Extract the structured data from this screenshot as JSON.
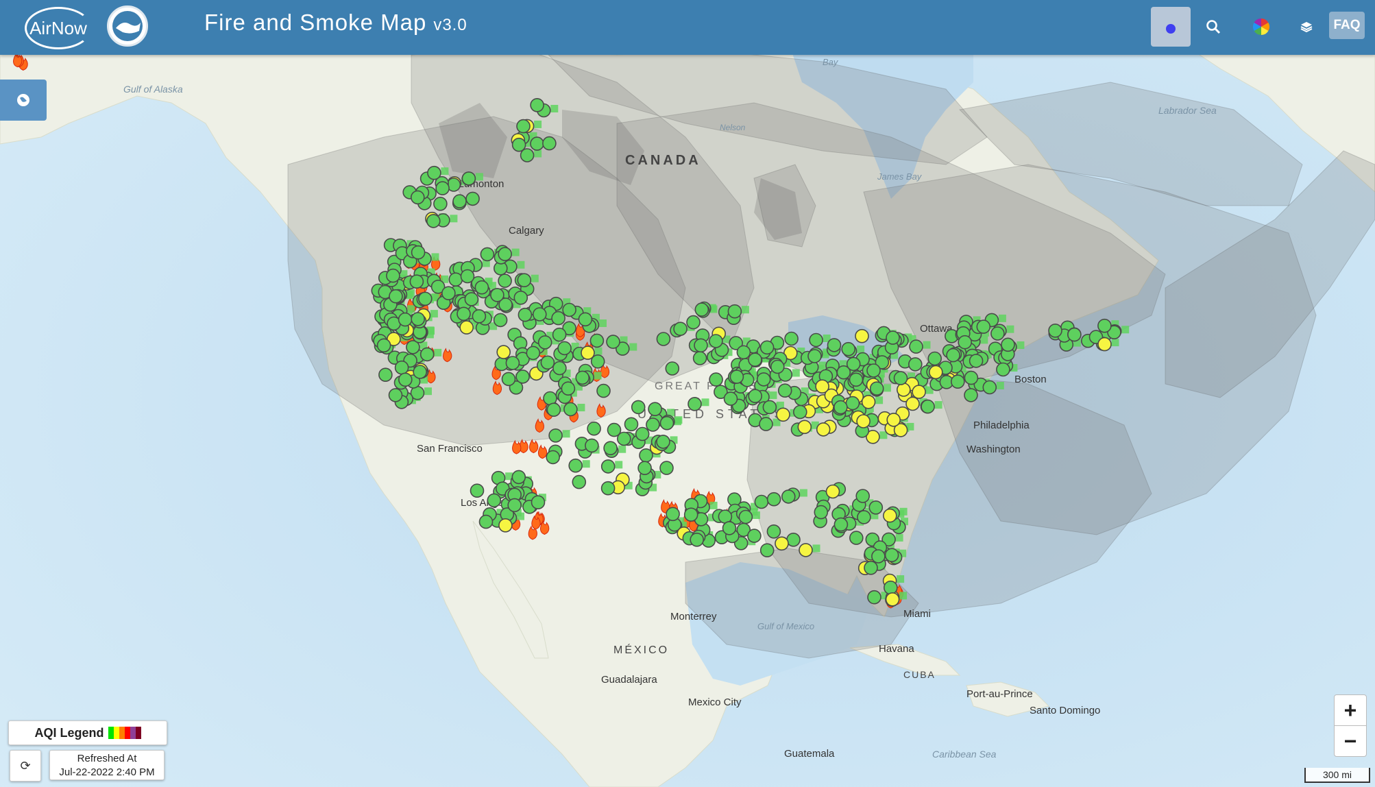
{
  "header": {
    "logo_text": "AirNow",
    "title": "Fire and Smoke Map",
    "version": "v3.0",
    "faq_label": "FAQ",
    "icons": [
      "monitor-points-icon",
      "search-icon",
      "color-wheel-icon",
      "layers-icon"
    ]
  },
  "legend": {
    "label": "AQI Legend",
    "colors": [
      "#00e400",
      "#ffff00",
      "#ff7e00",
      "#ff0000",
      "#8f3f97",
      "#7e0023"
    ]
  },
  "refresh": {
    "line1": "Refreshed At",
    "line2": "Jul-22-2022 2:40 PM"
  },
  "zoom": {
    "in": "+",
    "out": "−"
  },
  "scale": "300 mi",
  "colors": {
    "header": "#3d7fb0",
    "good": "#00e400",
    "moderate": "#ffff00",
    "water": "#cfe6f5",
    "land": "#eef0e6",
    "smoke": "#7a7a7a"
  },
  "map_labels": {
    "canada": "CANADA",
    "united_states": "UNITED STATES",
    "mexico": "MÉXICO",
    "cuba": "CUBA",
    "great_plains": "GREAT PLAINS",
    "gulf_of_alaska": "Gulf of Alaska",
    "labrador_sea": "Labrador Sea",
    "james_bay": "James Bay",
    "gulf_of_mexico": "Gulf of Mexico",
    "caribbean_sea": "Caribbean Sea",
    "bay": "Bay",
    "nelson": "Nelson",
    "edmonton": "Edmonton",
    "calgary": "Calgary",
    "ottawa": "Ottawa",
    "boston": "Boston",
    "philadelphia": "Philadelphia",
    "washington": "Washington",
    "san_francisco": "San Francisco",
    "los_angeles": "Los Angeles",
    "monterrey": "Monterrey",
    "guadalajara": "Guadalajara",
    "mexico_city": "Mexico City",
    "havana": "Havana",
    "miami": "Miami",
    "port_au_prince": "Port-au-Prince",
    "santo_domingo": "Santo Domingo",
    "guatemala": "Guatemala"
  }
}
